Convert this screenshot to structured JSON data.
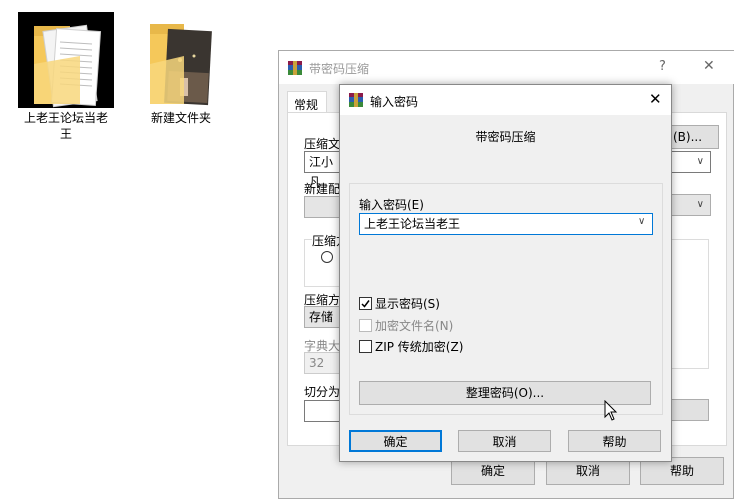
{
  "desktop": {
    "icons": [
      {
        "label_line1": "上老王论坛当老",
        "label_line2": "王"
      },
      {
        "label_line1": "新建文件夹",
        "label_line2": ""
      }
    ]
  },
  "back_window": {
    "title": "带密码压缩",
    "help_glyph": "?",
    "close_glyph": "✕",
    "tab_general": "常规",
    "browse_button": "(B)...",
    "label_archive_name": "压缩文",
    "archive_name_value": "江小凡",
    "label_new_profile": "新建配",
    "label_compress_group": "压缩方",
    "label_compress_method": "压缩方",
    "compress_method_value": "存储",
    "label_dict": "字典大",
    "dict_value": "32",
    "label_split": "切分为",
    "ok_button": "确定",
    "cancel_button": "取消",
    "help_button": "帮助"
  },
  "dialog": {
    "title": "输入密码",
    "close_glyph": "✕",
    "heading": "带密码压缩",
    "password_label": "输入密码(E)",
    "password_value": "上老王论坛当老王",
    "show_password_label": "显示密码(S)",
    "show_password_checked": true,
    "encrypt_filenames_label": "加密文件名(N)",
    "encrypt_filenames_checked": false,
    "zip_legacy_label": "ZIP 传统加密(Z)",
    "zip_legacy_checked": false,
    "organize_button": "整理密码(O)...",
    "ok_button": "确定",
    "cancel_button": "取消",
    "help_button": "帮助"
  },
  "colors": {
    "accent": "#0078d7",
    "folder": "#f5c85a",
    "window_bg": "#f0f0f0"
  }
}
